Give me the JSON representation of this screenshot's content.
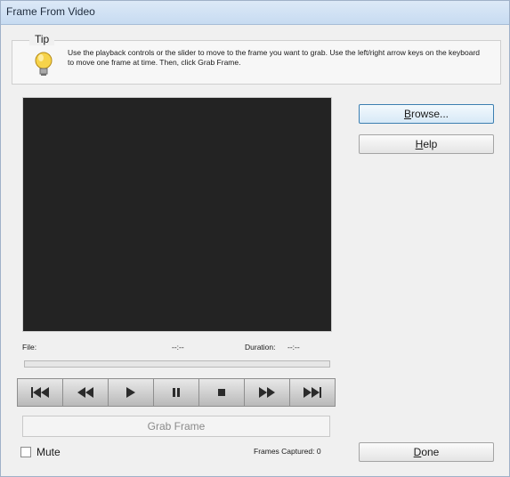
{
  "window": {
    "title": "Frame From Video"
  },
  "tip": {
    "legend": "Tip",
    "text": "Use the playback controls or the slider to move to the frame you want to grab. Use the left/right arrow keys on the keyboard to move one frame at time. Then, click Grab Frame."
  },
  "info": {
    "file_label": "File:",
    "file_value": "--:--",
    "duration_label": "Duration:",
    "duration_value": "--:--"
  },
  "buttons": {
    "browse": {
      "access": "B",
      "rest": "rowse..."
    },
    "help": {
      "access": "H",
      "rest": "elp"
    },
    "grab": {
      "access": "G",
      "rest": "rab Frame"
    },
    "done": {
      "access": "D",
      "rest": "one"
    }
  },
  "mute": {
    "access": "M",
    "rest": "ute"
  },
  "frames_captured": "Frames Captured: 0",
  "playback_controls": [
    "skip-to-start",
    "rewind",
    "play",
    "pause",
    "stop",
    "fast-forward",
    "skip-to-end"
  ]
}
